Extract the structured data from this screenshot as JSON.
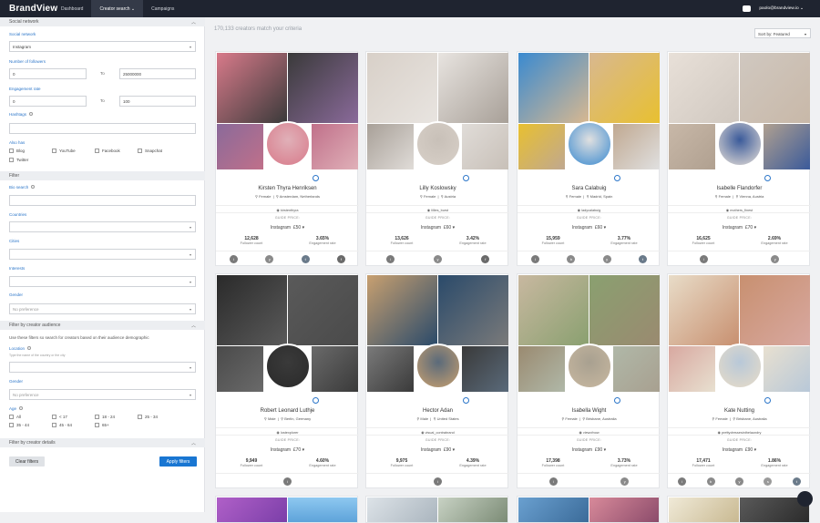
{
  "topbar": {
    "logo": "BrandView",
    "nav": [
      {
        "label": "Dashboard",
        "active": false
      },
      {
        "label": "Creator search ⌄",
        "active": true
      },
      {
        "label": "Campaigns",
        "active": false
      }
    ],
    "user_email": "paolo@brandview.io ⌄"
  },
  "sidebar": {
    "section_social": "Social network",
    "social_network_label": "Social network",
    "social_network_value": "Instagram",
    "followers_label": "Number of followers",
    "followers_from": "0",
    "followers_to_word": "To",
    "followers_to": "25000000",
    "engagement_label": "Engagement rate",
    "engagement_from": "0",
    "engagement_to_word": "To",
    "engagement_to": "100",
    "hashtags_label": "Hashtags",
    "also_has_label": "Also has",
    "also_has": [
      "Blog",
      "YouTube",
      "Facebook",
      "Snapchat",
      "Twitter"
    ],
    "section_filter": "Filter",
    "bio_label": "Bio search",
    "countries_label": "Countries",
    "cities_label": "Cities",
    "interests_label": "Interests",
    "gender_label": "Gender",
    "gender_placeholder": "No preference",
    "section_audience": "Filter by creator audience",
    "audience_help": "Use these filters so search for creators based on their audience demographic",
    "location_label": "Location",
    "location_hint": "Type the name of the country or the city",
    "audience_gender_label": "Gender",
    "audience_gender_placeholder": "No preference",
    "age_label": "Age",
    "ages": [
      "All",
      "< 17",
      "18 - 24",
      "25 - 34",
      "35 - 44",
      "45 - 64",
      "65+"
    ],
    "section_details": "Filter by creator details",
    "clear_label": "Clear filters",
    "apply_label": "Apply filters",
    "colors": {
      "link": "#2c76c9",
      "apply": "#1976d2"
    }
  },
  "main": {
    "count_text": "170,133 creators match your criteria",
    "sort_label": "Sort by: Featured",
    "guide_price_label": "GUIDE PRICE:",
    "followers_caption": "Follower count",
    "engagement_caption": "Engagement rate",
    "cards": [
      {
        "name": "Kirsten Thyra Henriksen",
        "gender": "Female",
        "location": "Amsterdam, Netherlands",
        "handle": "kirstenthyra",
        "platform": "Instagram",
        "price": "£50",
        "followers": "12,628",
        "engagement": "3.65%",
        "socials": [
          "ig",
          "yt",
          "tw",
          "fb"
        ]
      },
      {
        "name": "Lilly Koslowsky",
        "gender": "Female",
        "location": "Austria",
        "handle": "lillies_burst",
        "platform": "Instagram",
        "price": "£60",
        "followers": "13,626",
        "engagement": "3.42%",
        "socials": [
          "ig",
          "yt",
          "fb"
        ]
      },
      {
        "name": "Sara Calabuig",
        "gender": "Female",
        "location": "Madrid, Spain",
        "handle": "ladycalabuig",
        "platform": "Instagram",
        "price": "£60",
        "followers": "15,959",
        "engagement": "3.77%",
        "socials": [
          "ig",
          "bl",
          "yt",
          "tw"
        ]
      },
      {
        "name": "Isabelle Flandorfer",
        "gender": "Female",
        "location": "Vienna, Austria",
        "handle": "mothers_finest",
        "platform": "Instagram",
        "price": "£70",
        "followers": "16,625",
        "engagement": "2.69%",
        "socials": [
          "ig",
          "yt"
        ]
      },
      {
        "name": "Robert Leonard Luthje",
        "gender": "Male",
        "location": "Berlin, Germany",
        "handle": "lostexplorer",
        "platform": "Instagram",
        "price": "£70",
        "followers": "9,949",
        "engagement": "4.60%",
        "socials": [
          "ig"
        ]
      },
      {
        "name": "Hector Adan",
        "gender": "Male",
        "location": "United States",
        "handle": "visual_contrabrand",
        "platform": "Instagram",
        "price": "£90",
        "followers": "9,975",
        "engagement": "4.39%",
        "socials": [
          "ig"
        ]
      },
      {
        "name": "Isabella Wight",
        "gender": "Female",
        "location": "Brisbane, Australia",
        "handle": "viewofnow",
        "platform": "Instagram",
        "price": "£90",
        "followers": "17,398",
        "engagement": "3.73%",
        "socials": [
          "ig",
          "yt"
        ]
      },
      {
        "name": "Kate Nutting",
        "gender": "Female",
        "location": "Brisbane, Australia",
        "handle": "prettydressesinthelaundry",
        "platform": "Instagram",
        "price": "£90",
        "followers": "17,471",
        "engagement": "1.86%",
        "socials": [
          "ig",
          "bl",
          "yt",
          "sc",
          "tw"
        ]
      }
    ]
  }
}
